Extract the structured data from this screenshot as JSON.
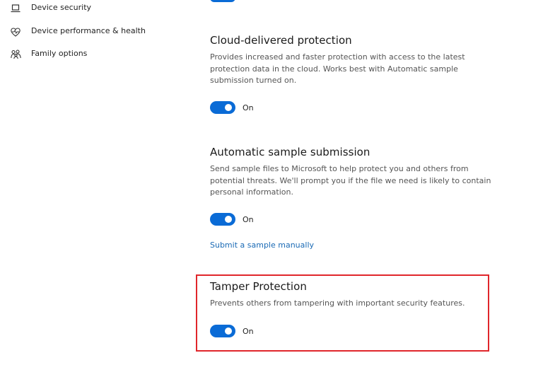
{
  "sidebar": {
    "items": [
      {
        "label": "Device security",
        "icon": "laptop-icon"
      },
      {
        "label": "Device performance & health",
        "icon": "heart-pulse-icon"
      },
      {
        "label": "Family options",
        "icon": "family-icon"
      }
    ]
  },
  "sections": {
    "cloud": {
      "title": "Cloud-delivered protection",
      "desc_lines": [
        "Provides increased and faster protection with access to the latest",
        "protection data in the cloud.  Works best with Automatic sample",
        "submission turned on."
      ],
      "toggle_state": "On"
    },
    "sample": {
      "title": "Automatic sample submission",
      "desc_lines": [
        "Send sample files to Microsoft to help protect you and others from",
        "potential threats.  We'll prompt you if the file we need is likely to contain",
        "personal information."
      ],
      "toggle_state": "On",
      "link": "Submit a sample manually"
    },
    "tamper": {
      "title": "Tamper Protection",
      "desc_lines": [
        "Prevents others from tampering with important security features."
      ],
      "toggle_state": "On"
    }
  },
  "colors": {
    "accent": "#0a6bd6",
    "link": "#1a6ab5",
    "highlight": "#e0262b"
  }
}
